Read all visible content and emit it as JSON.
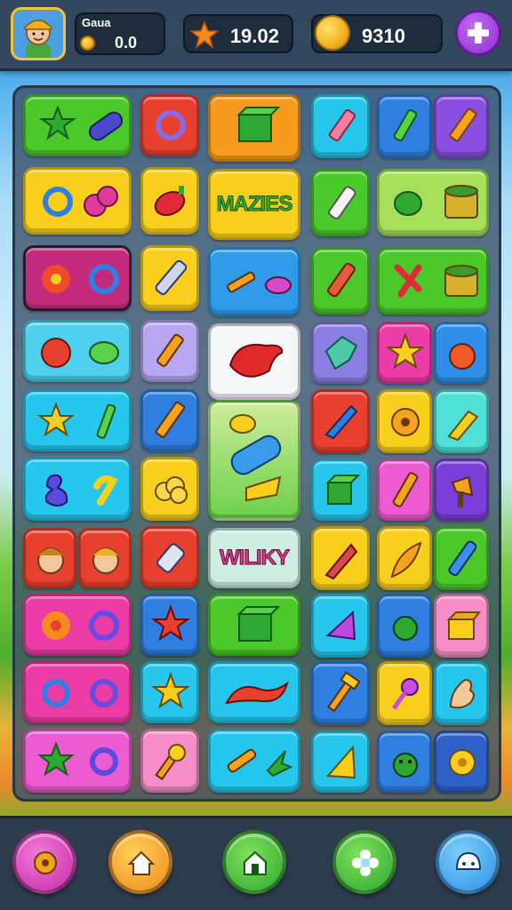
{
  "header": {
    "player_name": "Gauа",
    "player_coins": "0.0",
    "stars": "19.02",
    "gold": "9310"
  },
  "board": {
    "word_tile_1": "MAZIES",
    "word_tile_2": "WILIKY"
  },
  "colors": {
    "green": "#4cc92a",
    "red": "#e8402e",
    "orange": "#f59a1d",
    "cyan": "#27c6ec",
    "blue": "#2f7fe0",
    "purple": "#8a4fe0",
    "yellow": "#f7cf1c",
    "pink": "#ec3ca6",
    "lime": "#a6e05a",
    "magenta": "#c42a7c"
  },
  "icons": [
    "avatar-icon",
    "star-icon",
    "coin-icon",
    "plus-icon",
    "gear-icon",
    "home-icon",
    "shop-icon",
    "flower-icon",
    "chat-icon"
  ]
}
